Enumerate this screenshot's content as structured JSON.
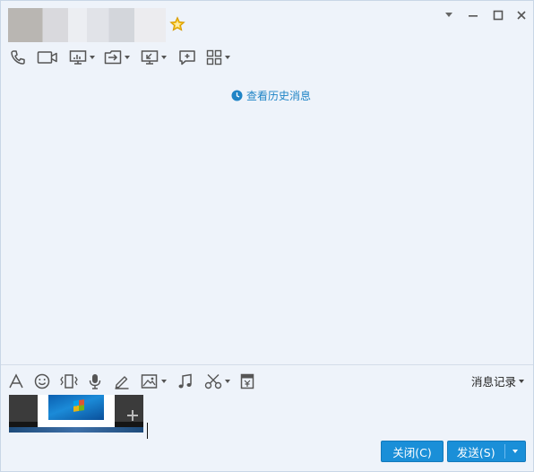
{
  "header": {
    "contact_name": "",
    "favorite_icon": "star-icon",
    "window_controls": [
      "dropdown-icon",
      "minimize-icon",
      "maximize-icon",
      "close-icon"
    ]
  },
  "toolbar": {
    "items": [
      "phone-icon",
      "video-icon",
      "screen-share-icon",
      "file-transfer-icon",
      "remote-desktop-icon",
      "new-chat-icon",
      "apps-icon"
    ]
  },
  "chat": {
    "history_link": "查看历史消息"
  },
  "input_toolbar": {
    "items": [
      "font-icon",
      "emoji-icon",
      "shake-icon",
      "voice-icon",
      "pen-icon",
      "image-icon",
      "music-icon",
      "screenshot-icon",
      "red-packet-icon"
    ],
    "record_label": "消息记录"
  },
  "footer": {
    "close_label": "关闭(C)",
    "send_label": "发送(S)"
  },
  "colors": {
    "accent": "#1a8fd8",
    "link": "#1f84c6",
    "background": "#eef3fa"
  }
}
